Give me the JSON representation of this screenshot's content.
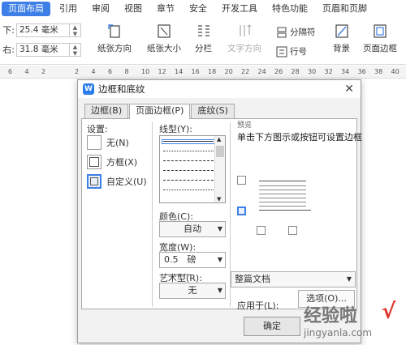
{
  "ribbon_tabs": [
    {
      "label": "页面布局",
      "active": true
    },
    {
      "label": "引用",
      "active": false
    },
    {
      "label": "审阅",
      "active": false
    },
    {
      "label": "视图",
      "active": false
    },
    {
      "label": "章节",
      "active": false
    },
    {
      "label": "安全",
      "active": false
    },
    {
      "label": "开发工具",
      "active": false
    },
    {
      "label": "特色功能",
      "active": false
    },
    {
      "label": "页眉和页脚",
      "active": false
    }
  ],
  "margins": {
    "bottom_label": "下:",
    "bottom_value": "25.4 毫米",
    "right_label": "右:",
    "right_value": "31.8 毫米"
  },
  "ribbon_buttons": {
    "orientation": "纸张方向",
    "size": "纸张大小",
    "columns": "分栏",
    "text_direction": "文字方向",
    "separator": "分隔符",
    "line_numbers": "行号",
    "background": "背景",
    "page_border": "页面边框"
  },
  "ruler_numbers": [
    "6",
    "4",
    "2",
    "",
    "2",
    "4",
    "6",
    "8",
    "10",
    "12",
    "14",
    "16",
    "18",
    "20",
    "22",
    "24",
    "26",
    "28",
    "30",
    "32",
    "34",
    "36",
    "38",
    "40"
  ],
  "dialog": {
    "title": "边框和底纹",
    "close": "✕",
    "tabs": [
      {
        "label": "边框(B)",
        "active": false
      },
      {
        "label": "页面边框(P)",
        "active": true
      },
      {
        "label": "底纹(S)",
        "active": false
      }
    ],
    "settings_label": "设置:",
    "settings": [
      {
        "label": "无(N)",
        "selected": false
      },
      {
        "label": "方框(X)",
        "selected": false
      },
      {
        "label": "自定义(U)",
        "selected": true
      }
    ],
    "line_style_label": "线型(Y):",
    "color_label": "颜色(C):",
    "color_value": "自动",
    "width_label": "宽度(W):",
    "width_value": "0.5　磅 ———",
    "art_label": "艺术型(R):",
    "art_value": "无",
    "preview_label": "预览",
    "preview_hint": "单击下方图示或按钮可设置边框",
    "apply_label": "应用于(L):",
    "apply_value": "整篇文档",
    "options_button": "选项(O)...",
    "ok_button": "确定"
  },
  "watermark": {
    "big": "经验啦",
    "small": "jingyanla.com",
    "check": "√"
  },
  "colors": {
    "accent": "#3d7fe6",
    "dialog_bg": "#f2f2f2",
    "watermark_check": "#e0342a"
  }
}
